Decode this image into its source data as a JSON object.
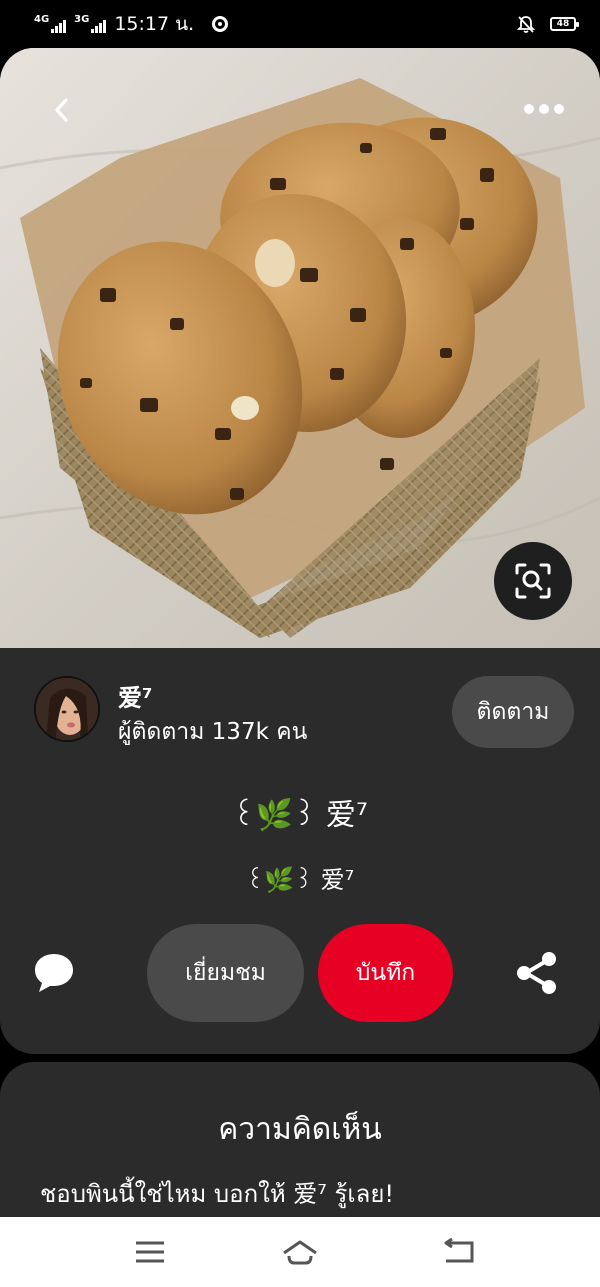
{
  "status_bar": {
    "net1": "4G",
    "net2": "3G",
    "time": "15:17 น.",
    "battery": "48"
  },
  "pin": {
    "author": {
      "name": "爱⁷",
      "followers": "ผู้ติดตาม 137k คน"
    },
    "follow_label": "ติดตาม",
    "title": "꒰🌿꒱ 爱⁷",
    "description": "꒰🌿꒱ 爱⁷",
    "visit_label": "เยี่ยมชม",
    "save_label": "บันทึก"
  },
  "comments": {
    "title": "ความคิดเห็น",
    "prompt": "ชอบพินนี้ใช่ไหม บอกให้ 爱⁷ รู้เลย!"
  },
  "icons": {
    "back": "chevron-left-icon",
    "more": "more-horizontal-icon",
    "lens": "visual-search-icon",
    "comment": "comment-bubble-icon",
    "share": "share-icon",
    "nav_menu": "menu-icon",
    "nav_home": "home-icon",
    "nav_back": "back-icon"
  },
  "colors": {
    "save_red": "#e60023",
    "card_bg": "#2b2b2b",
    "pill_bg": "#4a4a4a"
  }
}
